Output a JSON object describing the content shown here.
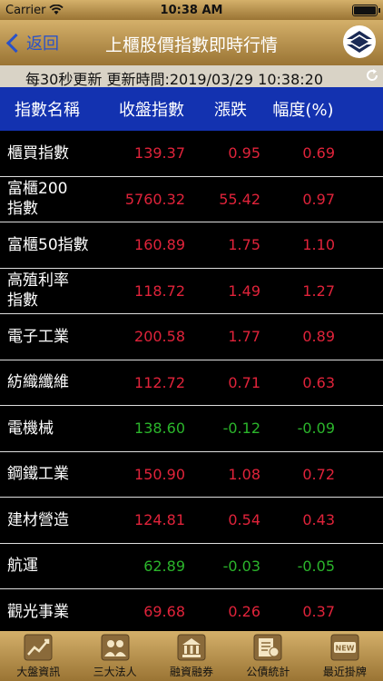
{
  "status_bar": {
    "carrier": "Carrier",
    "time": "10:38 AM"
  },
  "navbar": {
    "back_label": "返回",
    "title": "上櫃股價指數即時行情"
  },
  "info_bar": {
    "text": "每30秒更新 更新時間:2019/03/29 10:38:20"
  },
  "table": {
    "headers": [
      "指數名稱",
      "收盤指數",
      "漲跌",
      "幅度(%)"
    ],
    "rows": [
      {
        "name": "櫃買指數",
        "close": "139.37",
        "change": "0.95",
        "pct": "0.69",
        "dir": "up"
      },
      {
        "name": "富櫃200\n指數",
        "close": "5760.32",
        "change": "55.42",
        "pct": "0.97",
        "dir": "up"
      },
      {
        "name": "富櫃50指數",
        "close": "160.89",
        "change": "1.75",
        "pct": "1.10",
        "dir": "up"
      },
      {
        "name": "高殖利率\n指數",
        "close": "118.72",
        "change": "1.49",
        "pct": "1.27",
        "dir": "up"
      },
      {
        "name": "電子工業",
        "close": "200.58",
        "change": "1.77",
        "pct": "0.89",
        "dir": "up"
      },
      {
        "name": "紡織纖維",
        "close": "112.72",
        "change": "0.71",
        "pct": "0.63",
        "dir": "up"
      },
      {
        "name": "電機械",
        "close": "138.60",
        "change": "-0.12",
        "pct": "-0.09",
        "dir": "down"
      },
      {
        "name": "鋼鐵工業",
        "close": "150.90",
        "change": "1.08",
        "pct": "0.72",
        "dir": "up"
      },
      {
        "name": "建材營造",
        "close": "124.81",
        "change": "0.54",
        "pct": "0.43",
        "dir": "up"
      },
      {
        "name": "航運",
        "close": "62.89",
        "change": "-0.03",
        "pct": "-0.05",
        "dir": "down"
      },
      {
        "name": "觀光事業",
        "close": "69.68",
        "change": "0.26",
        "pct": "0.37",
        "dir": "up"
      }
    ]
  },
  "tab_bar": {
    "items": [
      {
        "label": "大盤資訊",
        "icon": "market-chart-icon"
      },
      {
        "label": "三大法人",
        "icon": "institutional-investors-icon"
      },
      {
        "label": "融資融券",
        "icon": "margin-trading-icon"
      },
      {
        "label": "公債統計",
        "icon": "bond-statistics-icon"
      },
      {
        "label": "最近掛牌",
        "icon": "new-listing-icon"
      }
    ]
  },
  "colors": {
    "gold": "#c8a45e",
    "header_blue": "#1332b0",
    "up": "#e0233a",
    "down": "#2bb52b",
    "back_blue": "#2a52c8"
  }
}
